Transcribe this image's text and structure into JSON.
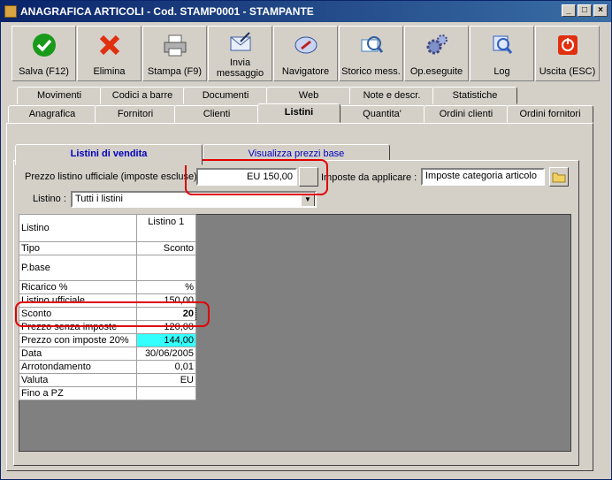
{
  "window": {
    "title": "ANAGRAFICA ARTICOLI - Cod. STAMP0001 - STAMPANTE",
    "controls": [
      "_",
      "□",
      "×"
    ]
  },
  "toolbar": [
    {
      "label": "Salva (F12)",
      "icon": "check-icon",
      "color": "#1a9a1a"
    },
    {
      "label": "Elimina",
      "icon": "delete-x-icon",
      "color": "#e03010"
    },
    {
      "label": "Stampa (F9)",
      "icon": "printer-icon",
      "color": "#606060"
    },
    {
      "label": "Invia messaggio",
      "icon": "envelope-icon",
      "color": "#4060a0"
    },
    {
      "label": "Navigatore",
      "icon": "compass-icon",
      "color": "#3050a0"
    },
    {
      "label": "Storico mess.",
      "icon": "magnifier-mail-icon",
      "color": "#4080c0"
    },
    {
      "label": "Op.eseguite",
      "icon": "gears-icon",
      "color": "#6070b0"
    },
    {
      "label": "Log",
      "icon": "log-search-icon",
      "color": "#3060c0"
    },
    {
      "label": "Uscita (ESC)",
      "icon": "power-icon",
      "color": "#e03010"
    }
  ],
  "tabs_row1": [
    "Movimenti",
    "Codici a barre",
    "Documenti",
    "Web",
    "Note e descr.",
    "Statistiche"
  ],
  "tabs_row2": [
    "Anagrafica",
    "Fornitori",
    "Clienti",
    "Listini",
    "Quantita'",
    "Ordini clienti",
    "Ordini fornitori"
  ],
  "active_tab": "Listini",
  "subtabs": [
    "Listini di vendita",
    "Visualizza prezzi base"
  ],
  "form": {
    "prezzo_label": "Prezzo listino ufficiale (imposte escluse) :",
    "prezzo_value": "EU 150,00",
    "imposte_label": "Imposte da applicare :",
    "imposte_value": "Imposte categoria articolo",
    "listino_label": "Listino :",
    "listino_value": "Tutti i listini"
  },
  "grid": {
    "header_label": "Listino",
    "column": "Listino 1",
    "rows": [
      {
        "label": "Tipo",
        "value": "Sconto"
      },
      {
        "label": "P.base",
        "value": ""
      },
      {
        "label": "Ricarico %",
        "value": "%"
      },
      {
        "label": "Listino ufficiale",
        "value": "150,00"
      },
      {
        "label": "Sconto",
        "value": "20"
      },
      {
        "label": "Prezzo senza imposte",
        "value": "120,00"
      },
      {
        "label": "Prezzo con imposte 20%",
        "value": "144,00"
      },
      {
        "label": "Data",
        "value": "30/06/2005"
      },
      {
        "label": "Arrotondamento",
        "value": "0,01"
      },
      {
        "label": "Valuta",
        "value": "EU"
      },
      {
        "label": "Fino a PZ",
        "value": ""
      }
    ]
  },
  "colors": {
    "highlight_cyan": "#33ffff",
    "annotation_red": "#e00000",
    "title_blue": "#0a246a"
  }
}
